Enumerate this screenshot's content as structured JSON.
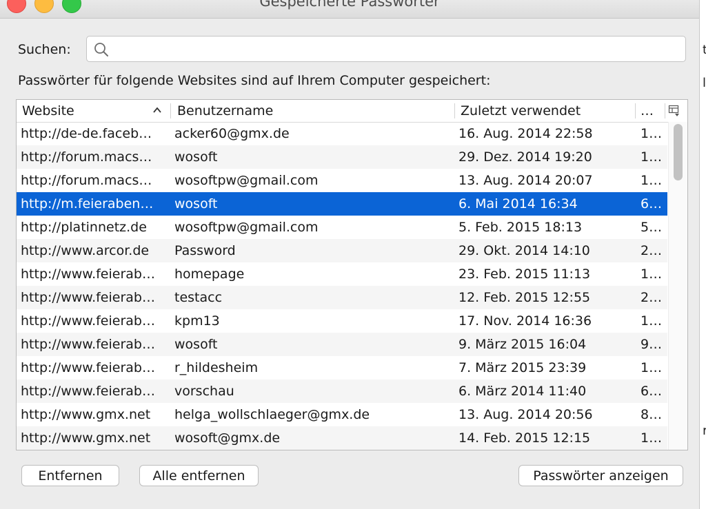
{
  "window": {
    "title": "Gespeicherte Passwörter"
  },
  "search": {
    "label": "Suchen:",
    "value": "",
    "placeholder": ""
  },
  "description": "Passwörter für folgende Websites sind auf Ihrem Computer gespeichert:",
  "table": {
    "columns": [
      "Website",
      "Benutzername",
      "Zuletzt verwendet",
      "…"
    ],
    "sort_column": "Website",
    "sort_direction": "ascending",
    "rows": [
      {
        "website": "http://de-de.faceb…",
        "user": "acker60@gmx.de",
        "last_used": "16. Aug. 2014 22:58",
        "extra": "1…"
      },
      {
        "website": "http://forum.macs…",
        "user": "wosoft",
        "last_used": "29. Dez. 2014 19:20",
        "extra": "1…"
      },
      {
        "website": "http://forum.macs…",
        "user": "wosoftpw@gmail.com",
        "last_used": "13. Aug. 2014 20:07",
        "extra": "1…"
      },
      {
        "website": "http://m.feieraben…",
        "user": "wosoft",
        "last_used": "6. Mai 2014 16:34",
        "extra": "6…",
        "selected": true
      },
      {
        "website": "http://platinnetz.de",
        "user": "wosoftpw@gmail.com",
        "last_used": "5. Feb. 2015 18:13",
        "extra": "5…"
      },
      {
        "website": "http://www.arcor.de",
        "user": "Password",
        "last_used": "29. Okt. 2014 14:10",
        "extra": "2…"
      },
      {
        "website": "http://www.feierab…",
        "user": "homepage",
        "last_used": "23. Feb. 2015 11:13",
        "extra": "1…"
      },
      {
        "website": "http://www.feierab…",
        "user": "testacc",
        "last_used": "12. Feb. 2015 12:55",
        "extra": "2…"
      },
      {
        "website": "http://www.feierab…",
        "user": "kpm13",
        "last_used": "17. Nov. 2014 16:36",
        "extra": "1…"
      },
      {
        "website": "http://www.feierab…",
        "user": "wosoft",
        "last_used": "9. März 2015 16:04",
        "extra": "9…"
      },
      {
        "website": "http://www.feierab…",
        "user": "r_hildesheim",
        "last_used": "7. März 2015 23:39",
        "extra": "1…"
      },
      {
        "website": "http://www.feierab…",
        "user": "vorschau",
        "last_used": "6. März 2014 11:40",
        "extra": "6…"
      },
      {
        "website": "http://www.gmx.net",
        "user": "helga_wollschlaeger@gmx.de",
        "last_used": "13. Aug. 2014 20:56",
        "extra": "8…"
      },
      {
        "website": "http://www.gmx.net",
        "user": "wosoft@gmx.de",
        "last_used": "14. Feb. 2015 12:15",
        "extra": "1…"
      }
    ]
  },
  "buttons": {
    "remove": "Entfernen",
    "remove_all": "Alle entfernen",
    "show_passwords": "Passwörter anzeigen"
  },
  "background_fragments": [
    "t",
    "l",
    "r"
  ],
  "colors": {
    "selection": "#0b64d6",
    "close": "#fc605c",
    "minimize": "#fdbc40",
    "maximize": "#34c84a"
  },
  "icons": [
    "search-icon",
    "sort-ascending-icon",
    "column-picker-icon"
  ]
}
